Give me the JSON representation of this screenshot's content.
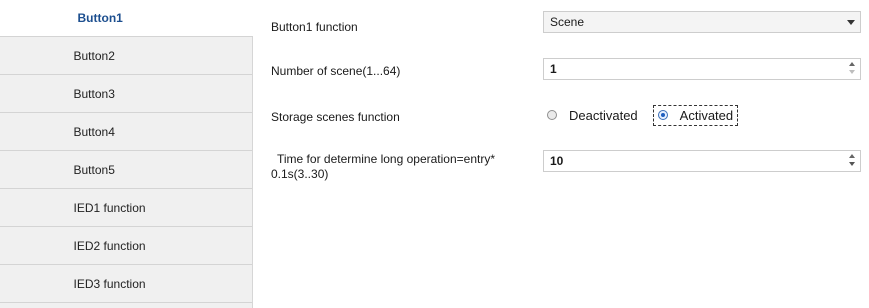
{
  "sidebar": {
    "items": [
      {
        "label": "Button1"
      },
      {
        "label": "Button2"
      },
      {
        "label": "Button3"
      },
      {
        "label": "Button4"
      },
      {
        "label": "Button5"
      },
      {
        "label": "IED1 function"
      },
      {
        "label": "IED2 function"
      },
      {
        "label": "IED3 function"
      }
    ]
  },
  "form": {
    "button_function": {
      "label": "Button1 function",
      "value": "Scene"
    },
    "scene_number": {
      "label": "Number of scene(1...64)",
      "value": "1"
    },
    "storage_scenes": {
      "label": "Storage scenes function",
      "options": [
        "Deactivated",
        "Activated"
      ],
      "selected": "Activated"
    },
    "long_operation": {
      "label_line1": "Time for determine long operation=entry*",
      "label_line2": "0.1s(3..30)",
      "value": "10"
    }
  }
}
